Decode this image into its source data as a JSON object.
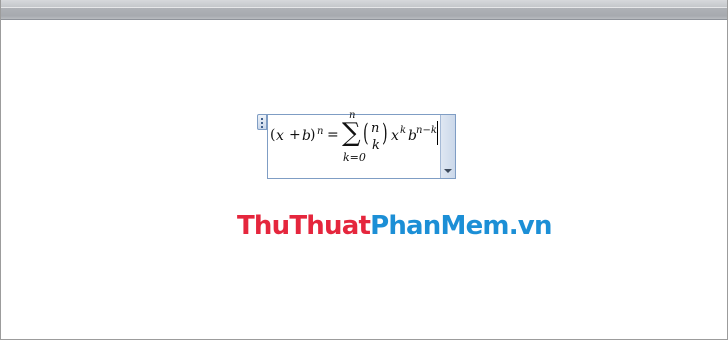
{
  "colors": {
    "logo_red": "#e5263d",
    "logo_blue": "#1c8fd6",
    "equation_border": "#7f9dc4"
  },
  "equation": {
    "lhs_open": "(",
    "lhs_x": "x",
    "lhs_plus": "+",
    "lhs_b": "b",
    "lhs_close": ")",
    "lhs_exp": "n",
    "equals": "=",
    "sum_symbol": "∑",
    "sum_upper": "n",
    "sum_lower": "k=0",
    "binom_open": "(",
    "binom_top": "n",
    "binom_bottom": "k",
    "binom_close": ")",
    "x_var": "x",
    "x_exp": "k",
    "b_var": "b",
    "b_exp": "n−k"
  },
  "icons": {
    "handle": "drag-dots-icon",
    "dropdown": "chevron-down-icon"
  },
  "logo": {
    "part1": "ThuThuat",
    "part2": "PhanMem.vn"
  }
}
